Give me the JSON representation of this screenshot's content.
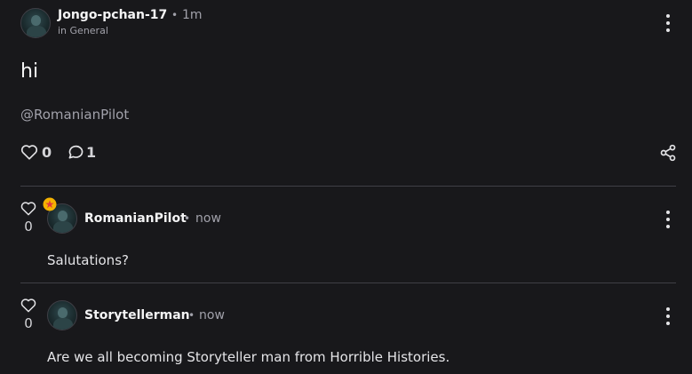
{
  "post": {
    "author": "Jongo-pchan-17",
    "separator": "•",
    "time": "1m",
    "in_prefix": "in",
    "category": "General",
    "title": "hi",
    "mention": "@RomanianPilot",
    "likes": "0",
    "replies": "1"
  },
  "comments": [
    {
      "votes": "0",
      "author": "RomanianPilot",
      "separator": "•",
      "time": "now",
      "body": "Salutations?",
      "badge_icon": "star-badge-icon",
      "badge_color": "#f5b301"
    },
    {
      "votes": "0",
      "author": "Storytellerman",
      "separator": "•",
      "time": "now",
      "body": "Are we all becoming Storyteller man from Horrible Histories."
    }
  ],
  "icons": {
    "like": "heart-icon",
    "reply": "comment-icon",
    "share": "share-icon",
    "menu": "more-vertical-icon"
  },
  "colors": {
    "background": "#18181b",
    "divider": "#3f3f46",
    "text": "#e4e4e7",
    "muted": "#a1a1aa"
  }
}
